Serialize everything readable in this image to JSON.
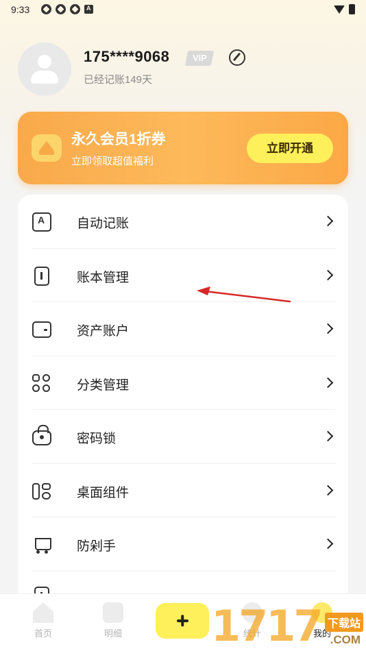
{
  "status_bar": {
    "time": "9:33"
  },
  "profile": {
    "phone": "175****9068",
    "vip_badge": "VIP",
    "days_text": "已经记账149天"
  },
  "banner": {
    "title": "永久会员1折券",
    "subtitle": "立即领取超值福利",
    "button_label": "立即开通"
  },
  "menu": {
    "items": [
      {
        "label": "自动记账",
        "icon": "auto-bookkeeping-icon"
      },
      {
        "label": "账本管理",
        "icon": "ledger-icon"
      },
      {
        "label": "资产账户",
        "icon": "wallet-icon"
      },
      {
        "label": "分类管理",
        "icon": "category-grid-icon"
      },
      {
        "label": "密码锁",
        "icon": "lock-icon"
      },
      {
        "label": "桌面组件",
        "icon": "widget-icon"
      },
      {
        "label": "防剁手",
        "icon": "cart-icon"
      }
    ]
  },
  "bottom_nav": {
    "items": [
      {
        "label": "首页",
        "icon": "home-icon"
      },
      {
        "label": "明细",
        "icon": "detail-icon"
      },
      {
        "label": "",
        "icon": "plus-icon"
      },
      {
        "label": "统计",
        "icon": "stats-icon"
      },
      {
        "label": "我的",
        "icon": "mine-icon"
      }
    ]
  },
  "watermark": {
    "digits": "1717",
    "text_top": "下载站",
    "text_bottom": ".COM"
  },
  "colors": {
    "accent_yellow": "#fef05a",
    "banner_orange": "#fdb95a",
    "arrow_red": "#d62828"
  }
}
